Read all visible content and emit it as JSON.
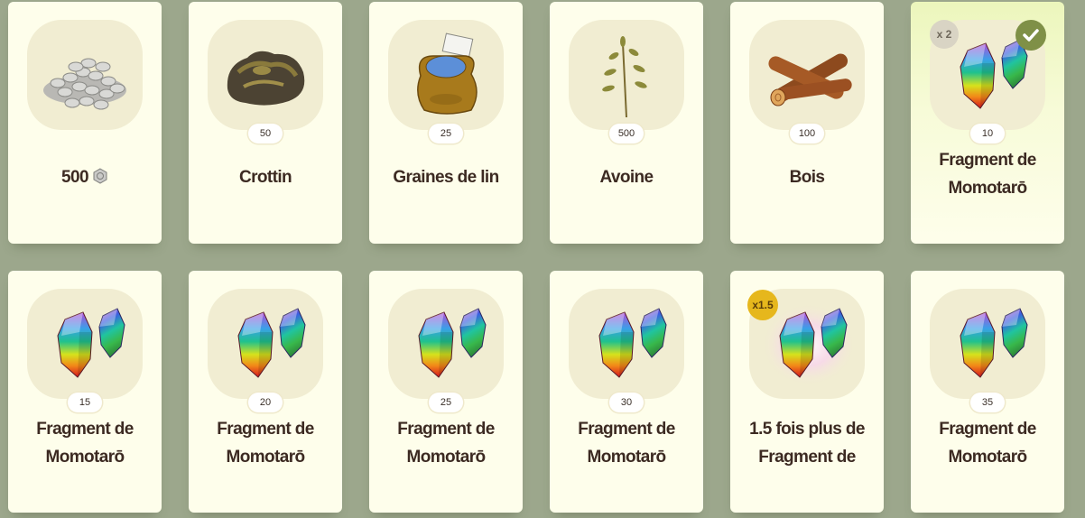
{
  "row1": [
    {
      "name": "silver-coins",
      "qty": "",
      "label": "500",
      "has_coin": true
    },
    {
      "name": "crottin",
      "qty": "50",
      "label": "Crottin"
    },
    {
      "name": "graines-de-lin",
      "qty": "25",
      "label": "Graines de lin"
    },
    {
      "name": "avoine",
      "qty": "500",
      "label": "Avoine"
    },
    {
      "name": "bois",
      "qty": "100",
      "label": "Bois"
    },
    {
      "name": "fragment",
      "qty": "10",
      "label_line1": "Fragment de",
      "label_line2": "Momotarō",
      "multiplier": "x 2",
      "collected": true
    }
  ],
  "row2": [
    {
      "name": "fragment",
      "qty": "15",
      "label_line1": "Fragment de",
      "label_line2": "Momotarō"
    },
    {
      "name": "fragment",
      "qty": "20",
      "label_line1": "Fragment de",
      "label_line2": "Momotarō"
    },
    {
      "name": "fragment",
      "qty": "25",
      "label_line1": "Fragment de",
      "label_line2": "Momotarō"
    },
    {
      "name": "fragment",
      "qty": "30",
      "label_line1": "Fragment de",
      "label_line2": "Momotarō"
    },
    {
      "name": "fragment-boost",
      "qty": "",
      "label_line1": "1.5 fois plus de",
      "label_line2": "Fragment de",
      "boost": "x1.5"
    },
    {
      "name": "fragment",
      "qty": "35",
      "label_line1": "Fragment de",
      "label_line2": "Momotarō"
    }
  ],
  "icons": {
    "coins": "silver-coins-icon",
    "crottin": "manure-icon",
    "lin": "seed-sack-icon",
    "avoine": "oat-plant-icon",
    "bois": "wood-logs-icon",
    "fragment": "rainbow-crystal-icon",
    "check": "checkmark-icon",
    "coin_small": "silver-coin-icon"
  },
  "colors": {
    "background": "#9ca78c",
    "card": "#fefeeb",
    "check_badge": "#7f9047",
    "boost_badge": "#e6b71c"
  }
}
